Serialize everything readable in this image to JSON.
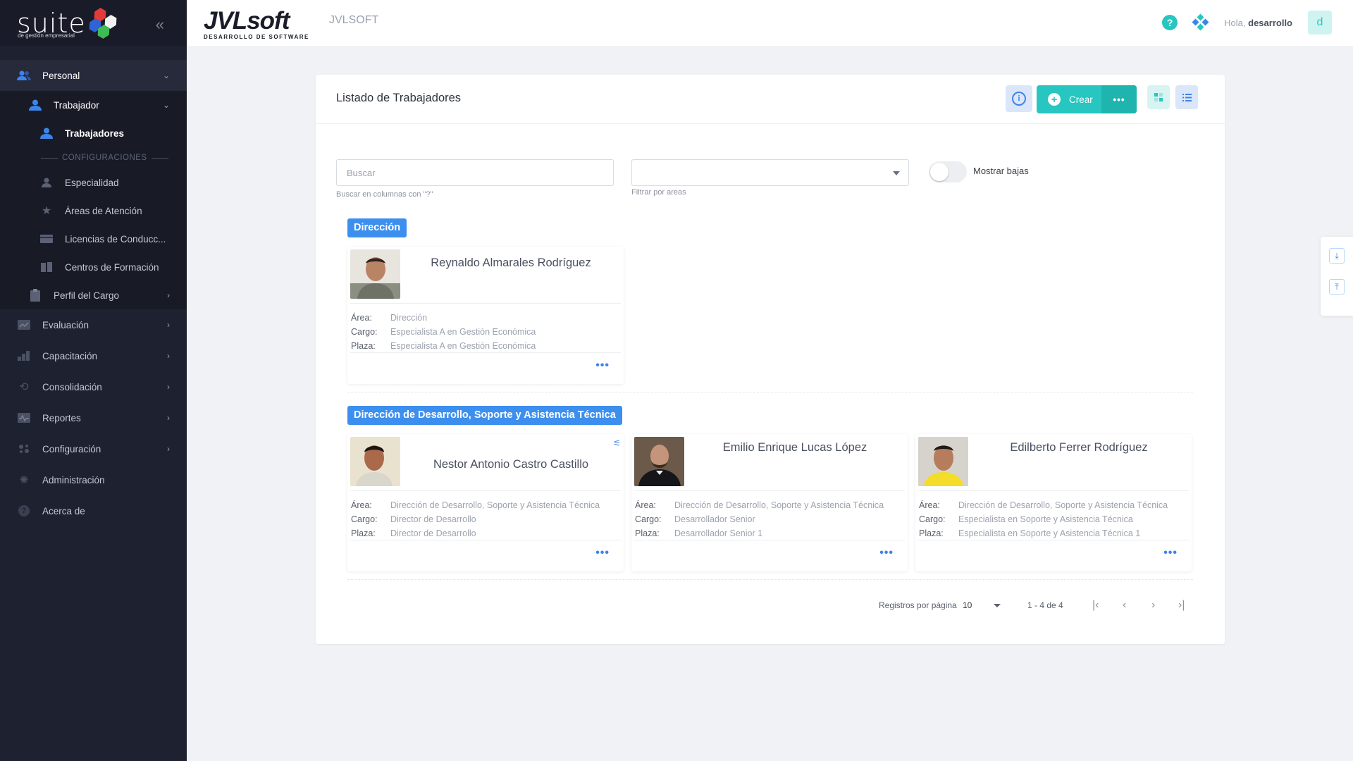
{
  "brand": {
    "word": "suite",
    "tagline": "de gestión empresarial"
  },
  "header": {
    "logo_main": "JVLsoft",
    "logo_sub": "DESARROLLO DE SOFTWARE",
    "app_name": "JVLSOFT",
    "greeting": "Hola,",
    "user": "desarrollo",
    "avatar_letter": "d"
  },
  "sidebar": {
    "personal": "Personal",
    "trabajador": "Trabajador",
    "trabajadores": "Trabajadores",
    "section_config": "CONFIGURACIONES",
    "especialidad": "Especialidad",
    "areas": "Áreas de Atención",
    "licencias": "Licencias de Conducc...",
    "centros": "Centros de Formación",
    "perfil": "Perfil del Cargo",
    "evaluacion": "Evaluación",
    "capacitacion": "Capacitación",
    "consolidacion": "Consolidación",
    "reportes": "Reportes",
    "configuracion": "Configuración",
    "administracion": "Administración",
    "acerca": "Acerca de"
  },
  "page": {
    "title": "Listado de Trabajadores",
    "crear_label": "Crear",
    "search_placeholder": "Buscar",
    "search_hint": "Buscar en columnas con \"?\"",
    "areas_hint": "Filtrar por areas",
    "toggle_label": "Mostrar bajas"
  },
  "labels": {
    "area": "Área:",
    "cargo": "Cargo:",
    "plaza": "Plaza:"
  },
  "groups": [
    {
      "name": "Dirección",
      "workers": [
        {
          "name": "Reynaldo Almarales Rodríguez",
          "area": "Dirección",
          "cargo": "Especialista A en Gestión Económica",
          "plaza": "Especialista A en Gestión Económica"
        }
      ]
    },
    {
      "name": "Dirección de Desarrollo, Soporte y Asistencia Técnica",
      "workers": [
        {
          "name": "Nestor Antonio Castro Castillo",
          "area": "Dirección de Desarrollo, Soporte y Asistencia Técnica",
          "cargo": "Director de Desarrollo",
          "plaza": "Director de Desarrollo"
        },
        {
          "name": "Emilio Enrique Lucas López",
          "area": "Dirección de Desarrollo, Soporte y Asistencia Técnica",
          "cargo": "Desarrollador Senior",
          "plaza": "Desarrollador Senior 1"
        },
        {
          "name": "Edilberto Ferrer Rodríguez",
          "area": "Dirección de Desarrollo, Soporte y Asistencia Técnica",
          "cargo": "Especialista en Soporte y Asistencia Técnica",
          "plaza": "Especialista en Soporte y Asistencia Técnica 1"
        }
      ]
    }
  ],
  "pagination": {
    "per_page_label": "Registros por página",
    "per_page": "10",
    "range": "1 - 4 de 4"
  },
  "colors": {
    "accent": "#27c6c0",
    "primary": "#3d8fef",
    "sidebar": "#1e2130"
  },
  "icons": [
    "help-icon",
    "apps-icon",
    "info-icon",
    "plus-icon",
    "grid-view-icon",
    "list-view-icon",
    "download-icon",
    "upload-icon"
  ]
}
